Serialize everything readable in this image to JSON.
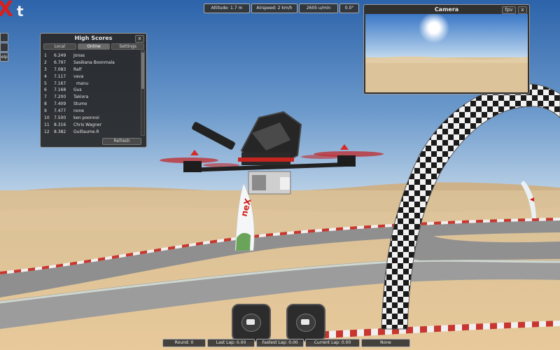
{
  "logo": {
    "letter_x": "X",
    "letter_t": "t"
  },
  "side_buttons": {
    "help_label": "Help"
  },
  "telemetry": {
    "altitude": "Altitude: 1.7 m",
    "airspeed": "Airspeed: 2 km/h",
    "rpm": "2605 u/min",
    "angle": "0.0°"
  },
  "high_scores": {
    "title": "High Scores",
    "close_label": "x",
    "tabs": [
      "Local",
      "Online",
      "Settings"
    ],
    "active_tab": "Online",
    "rows": [
      {
        "rank": "1",
        "time": "6.249",
        "name": "Jonas"
      },
      {
        "rank": "2",
        "time": "6.797",
        "name": "Sasikana Boonmala"
      },
      {
        "rank": "3",
        "time": "7.083",
        "name": "Ralf"
      },
      {
        "rank": "4",
        "time": "7.117",
        "name": "vava"
      },
      {
        "rank": "5",
        "time": "7.167",
        "name": "manu"
      },
      {
        "rank": "6",
        "time": "7.168",
        "name": "Gus"
      },
      {
        "rank": "7",
        "time": "7.200",
        "name": "Takiora"
      },
      {
        "rank": "8",
        "time": "7.409",
        "name": "Stumo"
      },
      {
        "rank": "9",
        "time": "7.477",
        "name": "none"
      },
      {
        "rank": "10",
        "time": "7.500",
        "name": "ken poonnoi"
      },
      {
        "rank": "11",
        "time": "8.316",
        "name": "Chris Wagner"
      },
      {
        "rank": "12",
        "time": "8.382",
        "name": "Guillaume.R"
      }
    ],
    "refresh_label": "Refresh"
  },
  "camera": {
    "title": "Camera",
    "mode_label": "fpv",
    "close_label": "x"
  },
  "race_status": {
    "round": "Round: 0",
    "last_lap": "Last Lap: 0.00",
    "fastest_lap": "Fastest Lap: 0.00",
    "current_lap": "Current Lap: 0.00",
    "mode": "None"
  },
  "banner_text": "neX",
  "colors": {
    "panel_bg": "#282828",
    "accent_red": "#e0201c",
    "sky_top": "#2f6fb8",
    "sand": "#d9b98a",
    "track": "#8a8a8a"
  },
  "icons": [
    "close-icon",
    "checkered-arch-icon",
    "quadcopter-drone-icon",
    "gimbal-stick-icon"
  ]
}
